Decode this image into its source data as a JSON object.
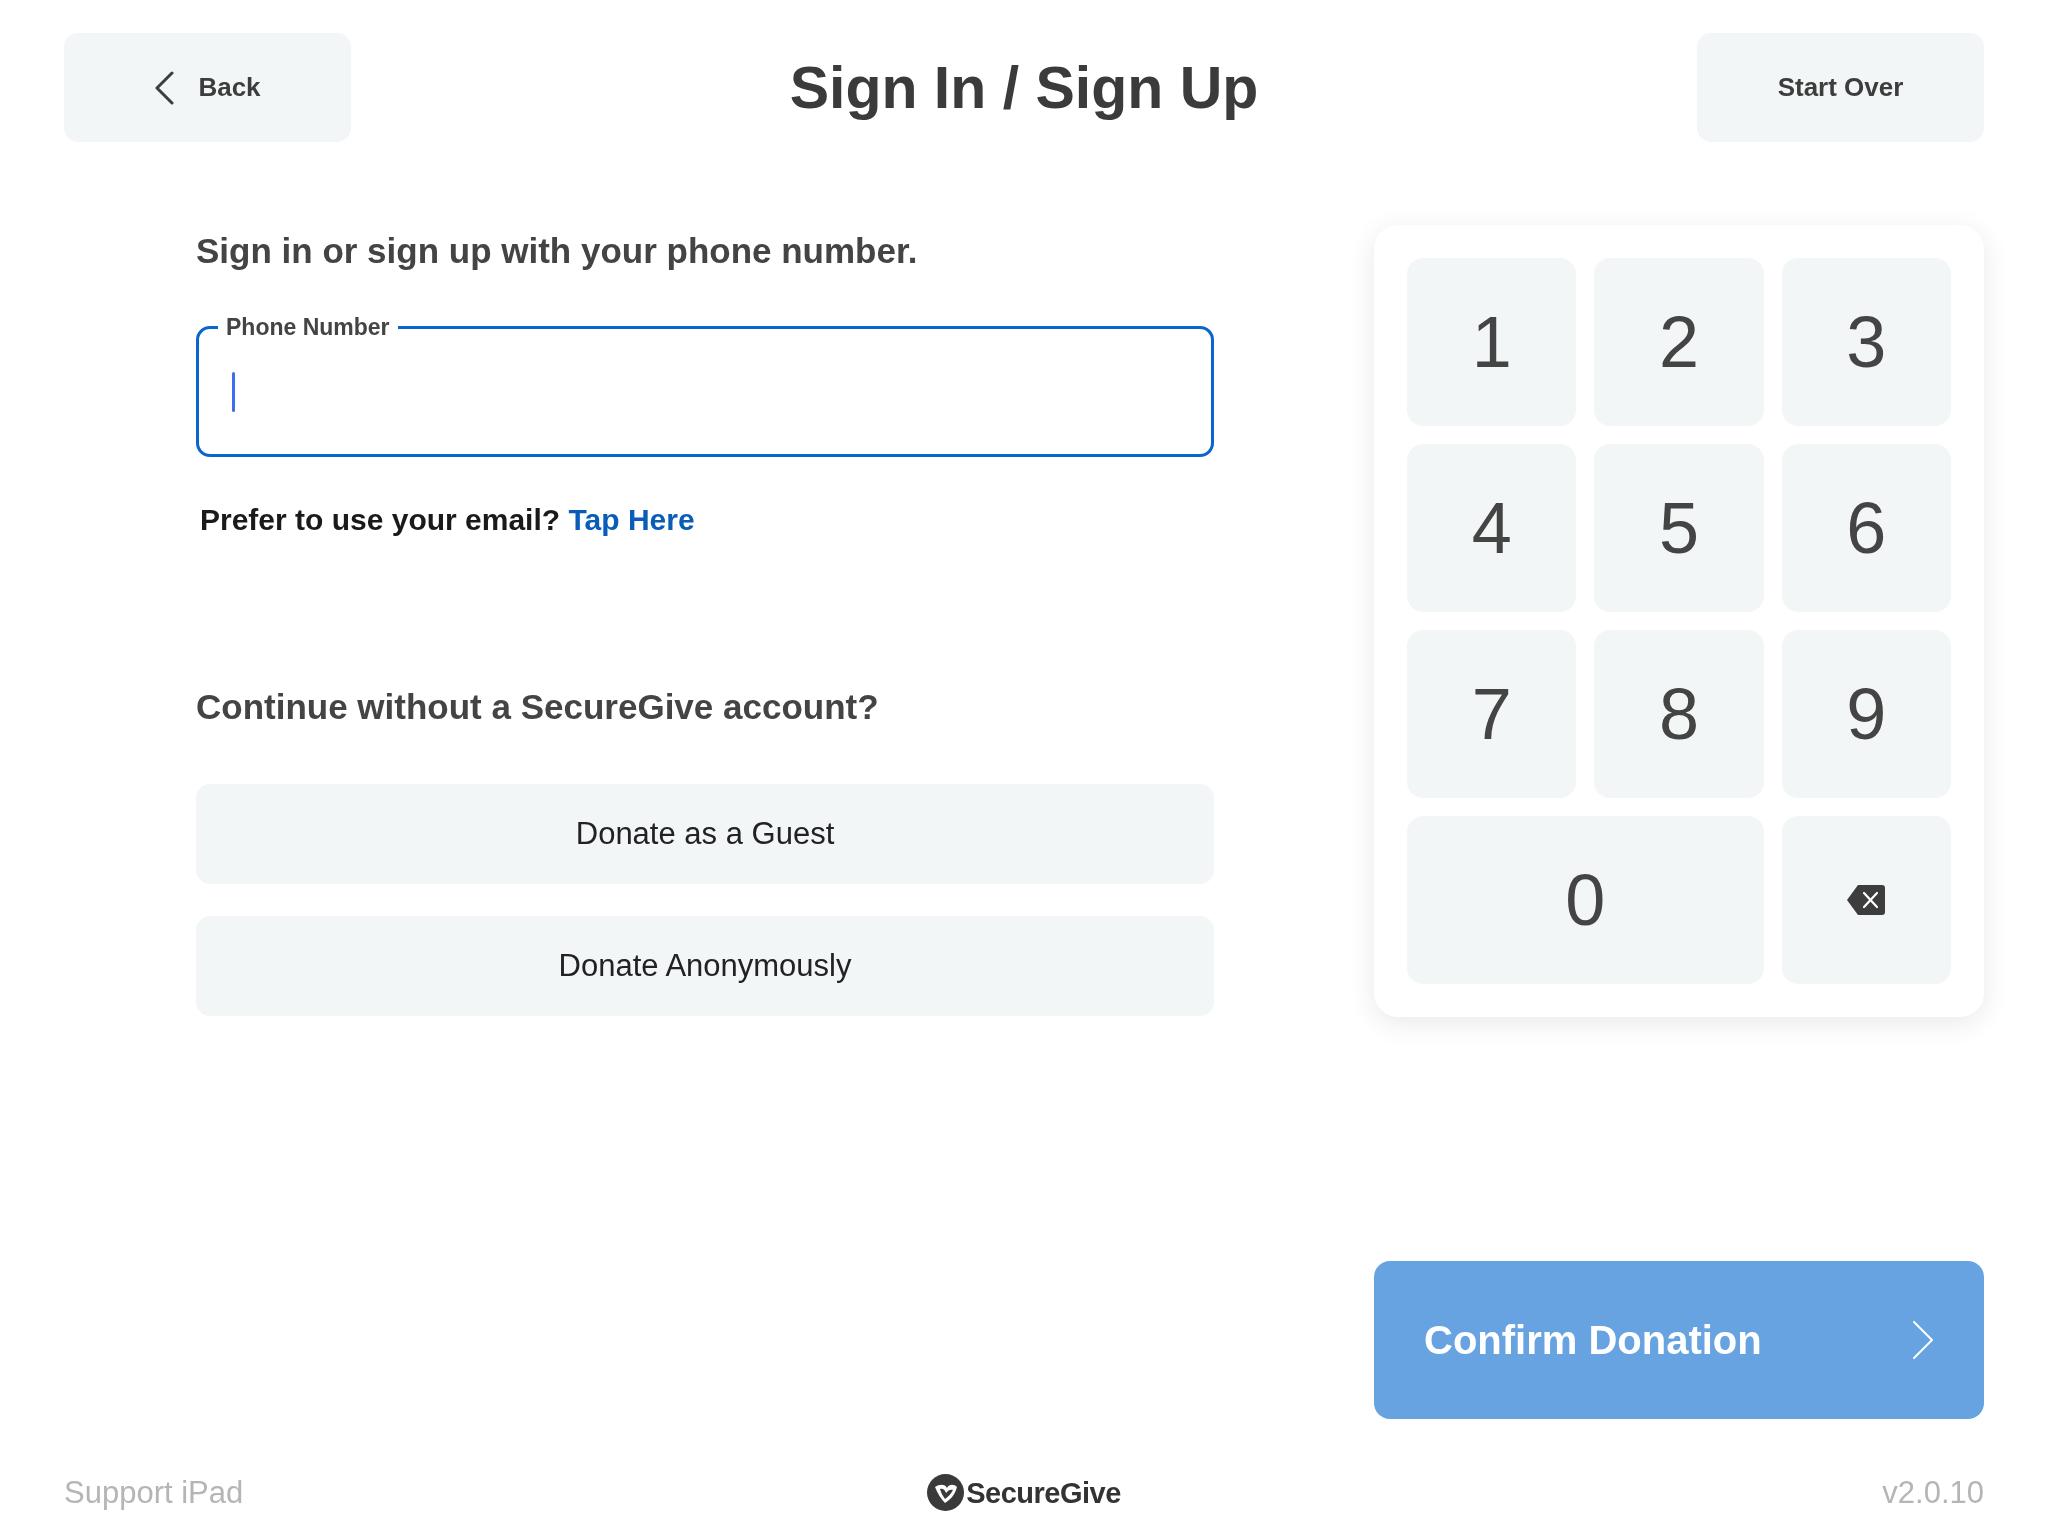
{
  "header": {
    "back_button": {
      "label": "Back"
    },
    "title": "Sign In / Sign Up",
    "start_over_button": {
      "label": "Start Over"
    }
  },
  "sign_in": {
    "heading": "Sign in or sign up with your phone number.",
    "phone_field": {
      "label": "Phone Number",
      "focused": true
    },
    "email_prompt": {
      "text": "Prefer to use your email?",
      "link": "Tap Here"
    }
  },
  "guest": {
    "heading": "Continue without a SecureGive account?",
    "buttons": [
      {
        "label": "Donate as a Guest"
      },
      {
        "label": "Donate Anonymously"
      }
    ]
  },
  "keypad": {
    "keys": [
      {
        "kind": "digit",
        "label": "1",
        "wide": false
      },
      {
        "kind": "digit",
        "label": "2",
        "wide": false
      },
      {
        "kind": "digit",
        "label": "3",
        "wide": false
      },
      {
        "kind": "digit",
        "label": "4",
        "wide": false
      },
      {
        "kind": "digit",
        "label": "5",
        "wide": false
      },
      {
        "kind": "digit",
        "label": "6",
        "wide": false
      },
      {
        "kind": "digit",
        "label": "7",
        "wide": false
      },
      {
        "kind": "digit",
        "label": "8",
        "wide": false
      },
      {
        "kind": "digit",
        "label": "9",
        "wide": false
      },
      {
        "kind": "digit",
        "label": "0",
        "wide": true
      },
      {
        "kind": "backspace",
        "wide": false
      }
    ]
  },
  "confirm_button": {
    "label": "Confirm Donation",
    "disabled": true
  },
  "footer": {
    "support_link": "Support iPad",
    "logo_text": "SecureGive",
    "version": "v2.0.10"
  }
}
